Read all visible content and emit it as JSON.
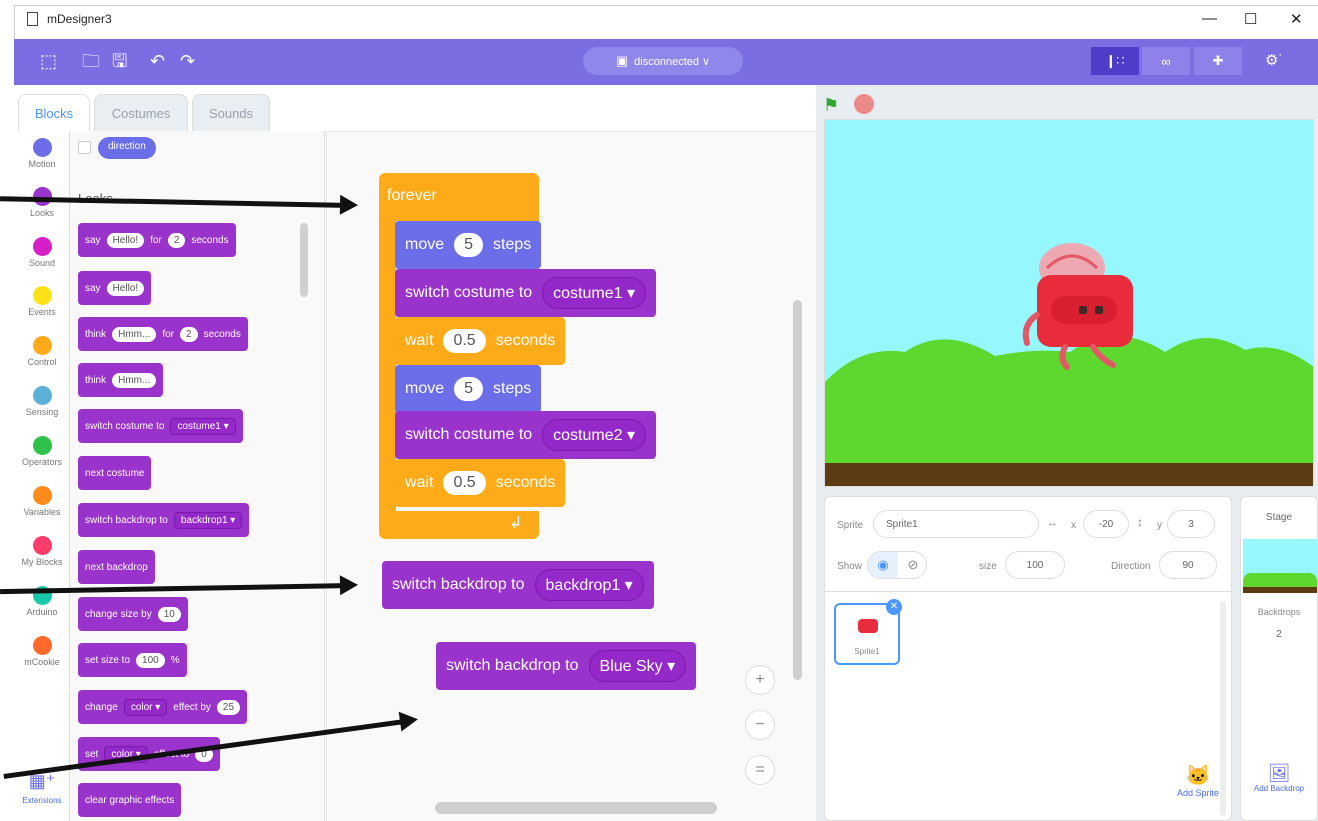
{
  "window": {
    "title": "mDesigner3",
    "minimize": "—",
    "maximize": "☐",
    "close": "✕"
  },
  "menubar": {
    "connection_label": "disconnected ∨"
  },
  "tabs": [
    {
      "label": "Blocks"
    },
    {
      "label": "Costumes"
    },
    {
      "label": "Sounds"
    }
  ],
  "categories": [
    {
      "label": "Motion",
      "color": "#4c97ff"
    },
    {
      "label": "Looks",
      "color": "#9966ff"
    },
    {
      "label": "Sound",
      "color": "#cf63cf"
    },
    {
      "label": "Events",
      "color": "#ffd500"
    },
    {
      "label": "Control",
      "color": "#ffab19"
    },
    {
      "label": "Sensing",
      "color": "#5cb1d6"
    },
    {
      "label": "Operators",
      "color": "#59c059"
    },
    {
      "label": "Variables",
      "color": "#ff8c1a"
    },
    {
      "label": "My Blocks",
      "color": "#ff6680"
    },
    {
      "label": "Arduino",
      "color": "#00b295"
    },
    {
      "label": "mCookie",
      "color": "#ff6a2a"
    }
  ],
  "extensions_label": "Extensions",
  "palette": {
    "direction": "direction",
    "section": "Looks",
    "say_for": {
      "say": "say",
      "text": "Hello!",
      "for": "for",
      "num": "2",
      "unit": "seconds"
    },
    "say": {
      "say": "say",
      "text": "Hello!"
    },
    "think_for": {
      "think": "think",
      "text": "Hmm...",
      "for": "for",
      "num": "2",
      "unit": "seconds"
    },
    "think": {
      "think": "think",
      "text": "Hmm..."
    },
    "switch_costume": {
      "label": "switch costume to",
      "value": "costume1 ▾"
    },
    "next_costume": "next costume",
    "switch_backdrop": {
      "label": "switch backdrop to",
      "value": "backdrop1 ▾"
    },
    "next_backdrop": "next backdrop",
    "change_size": {
      "label": "change size by",
      "num": "10"
    },
    "set_size": {
      "label": "set size to",
      "num": "100",
      "unit": "%"
    },
    "change_effect": {
      "label": "change",
      "value": "color ▾",
      "by": "effect by",
      "num": "25"
    },
    "set_effect": {
      "label": "set",
      "value": "color ▾",
      "to": "effect to",
      "num": "0"
    },
    "clear_effects": "clear graphic effects"
  },
  "script": {
    "forever": "forever",
    "move1": {
      "move": "move",
      "num": "5",
      "steps": "steps"
    },
    "costume1": {
      "label": "switch costume to",
      "value": "costume1 ▾"
    },
    "wait1": {
      "wait": "wait",
      "num": "0.5",
      "seconds": "seconds"
    },
    "move2": {
      "move": "move",
      "num": "5",
      "steps": "steps"
    },
    "costume2": {
      "label": "switch costume to",
      "value": "costume2 ▾"
    },
    "wait2": {
      "wait": "wait",
      "num": "0.5",
      "seconds": "seconds"
    },
    "loop_arrow": "↲",
    "backdrop1": {
      "label": "switch backdrop to",
      "value": "backdrop1 ▾"
    },
    "backdrop2": {
      "label": "switch backdrop to",
      "value": "Blue Sky ▾"
    }
  },
  "zoom": {
    "in": "+",
    "out": "−",
    "reset": "="
  },
  "sprite_info": {
    "sprite_label": "Sprite",
    "sprite_name": "Sprite1",
    "x_label": "x",
    "x": "-20",
    "y_label": "y",
    "y": "3",
    "show_label": "Show",
    "size_label": "size",
    "size": "100",
    "direction_label": "Direction",
    "direction": "90"
  },
  "sprite_thumb": "Sprite1",
  "add_sprite": "Add Sprite",
  "stage_panel": {
    "title": "Stage",
    "backdrops_label": "Backdrops",
    "backdrops_count": "2",
    "add_backdrop": "Add Backdrop"
  },
  "colors": {
    "menubar": "#7b6ee3",
    "looks": "#9933cc",
    "motion": "#6b6ee8",
    "control": "#ffab19",
    "stage_sky": "#97f7ff",
    "grass": "#5ed82e",
    "ground": "#5c3a12"
  }
}
